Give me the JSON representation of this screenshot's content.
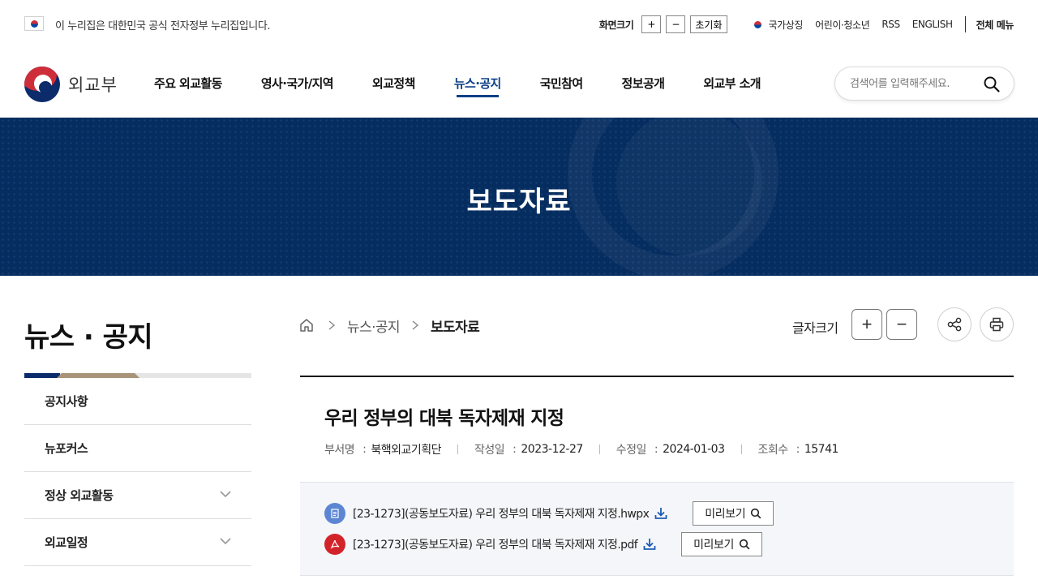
{
  "topbar": {
    "gov_notice": "이 누리집은 대한민국 공식 전자정부 누리집입니다.",
    "screen_size_label": "화면크기",
    "zoom_in": "+",
    "zoom_out": "−",
    "reset": "초기화",
    "national_symbol": "국가상징",
    "kids": "어린이·청소년",
    "rss": "RSS",
    "english": "ENGLISH",
    "all_menu": "전체 메뉴"
  },
  "header": {
    "logo_text": "외교부",
    "nav": [
      {
        "label": "주요 외교활동"
      },
      {
        "label": "영사·국가/지역"
      },
      {
        "label": "외교정책"
      },
      {
        "label": "뉴스·공지"
      },
      {
        "label": "국민참여"
      },
      {
        "label": "정보공개"
      },
      {
        "label": "외교부 소개"
      }
    ],
    "active_nav_index": 3,
    "search_placeholder": "검색어를 입력해주세요."
  },
  "hero": {
    "title": "보도자료"
  },
  "sidebar": {
    "title": "뉴스 · 공지",
    "items": [
      {
        "label": "공지사항",
        "expandable": false
      },
      {
        "label": "뉴포커스",
        "expandable": false
      },
      {
        "label": "정상 외교활동",
        "expandable": true
      },
      {
        "label": "외교일정",
        "expandable": true
      }
    ]
  },
  "breadcrumb": {
    "items": [
      "뉴스·공지",
      "보도자료"
    ]
  },
  "tools": {
    "font_size_label": "글자크기",
    "plus": "+",
    "minus": "−"
  },
  "article": {
    "title": "우리 정부의 대북 독자제재 지정",
    "meta": {
      "dept_label": "부서명",
      "dept": "북핵외교기획단",
      "created_label": "작성일",
      "created": "2023-12-27",
      "modified_label": "수정일",
      "modified": "2024-01-03",
      "views_label": "조회수",
      "views": "15741"
    },
    "files": [
      {
        "type": "hwp",
        "name": "[23-1273](공동보도자료) 우리 정부의 대북 독자제재 지정.hwpx",
        "preview": "미리보기"
      },
      {
        "type": "pdf",
        "name": "[23-1273](공동보도자료) 우리 정부의 대북 독자제재 지정.pdf",
        "preview": "미리보기"
      }
    ]
  },
  "colors": {
    "brand_navy": "#062d5f",
    "active_nav": "#0b3f86",
    "accent_gold": "#a79479"
  }
}
